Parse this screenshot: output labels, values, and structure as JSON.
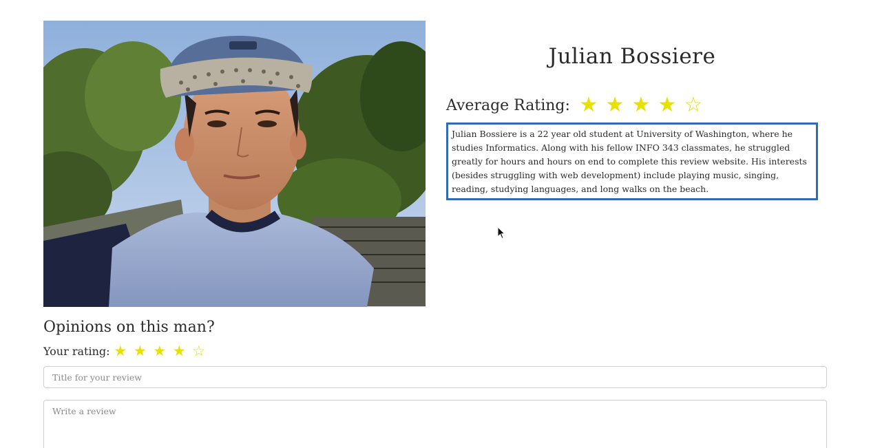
{
  "profile": {
    "name": "Julian Bossiere",
    "photo_icon": "profile-photo",
    "average_rating_label": "Average Rating:",
    "average_rating": 4,
    "average_rating_max": 5,
    "bio": "Julian Bossiere is a 22 year old student at University of Washington, where he studies Informatics. Along with his fellow INFO 343 classmates, he struggled greatly for hours and hours on end to complete this review website. His interests (besides struggling with web development) include playing music, singing, reading, studying languages, and long walks on the beach."
  },
  "review_form": {
    "heading": "Opinions on this man?",
    "your_rating_label": "Your rating:",
    "your_rating": 4,
    "your_rating_max": 5,
    "title_placeholder": "Title for your review",
    "title_value": "",
    "body_placeholder": "Write a review",
    "body_value": ""
  },
  "colors": {
    "star_fill": "#e8e000",
    "bio_border": "#2f6db0",
    "input_border": "#cfcfcf"
  },
  "icons": {
    "filled_star": "star-filled-icon",
    "empty_star": "star-empty-icon",
    "cursor": "mouse-pointer-icon"
  }
}
